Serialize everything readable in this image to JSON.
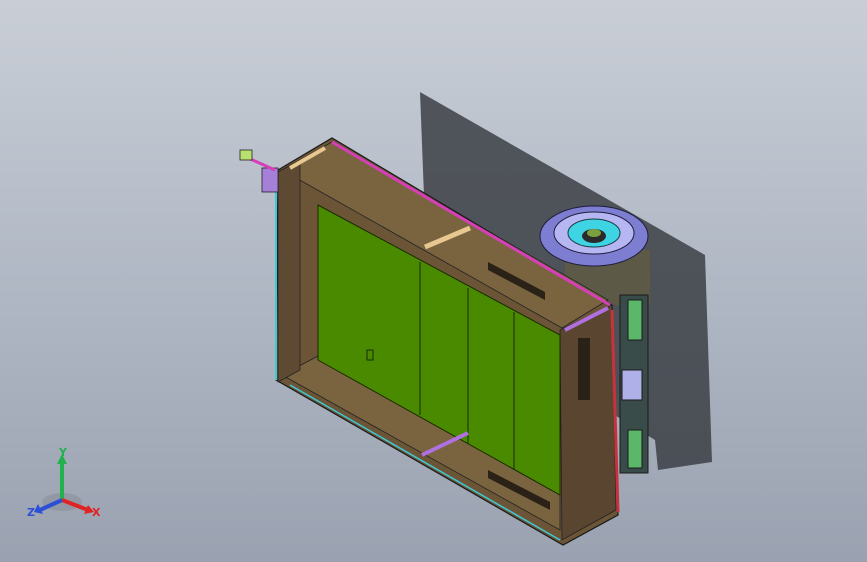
{
  "viewport": {
    "background_top": "#c9ced6",
    "background_bottom": "#9aa2b1"
  },
  "model": {
    "frame_color": "#6b5536",
    "panel_color": "#4a8a00",
    "fan_color": "#8a8ad8",
    "accent_pink": "#d63fb8",
    "accent_red": "#c8323c",
    "accent_cyan": "#3ec9d6",
    "accent_tan": "#e8c890"
  },
  "triad": {
    "x_label": "X",
    "y_label": "Y",
    "z_label": "Z",
    "x_color": "#e02424",
    "y_color": "#22b14c",
    "z_color": "#2b4fd6"
  }
}
